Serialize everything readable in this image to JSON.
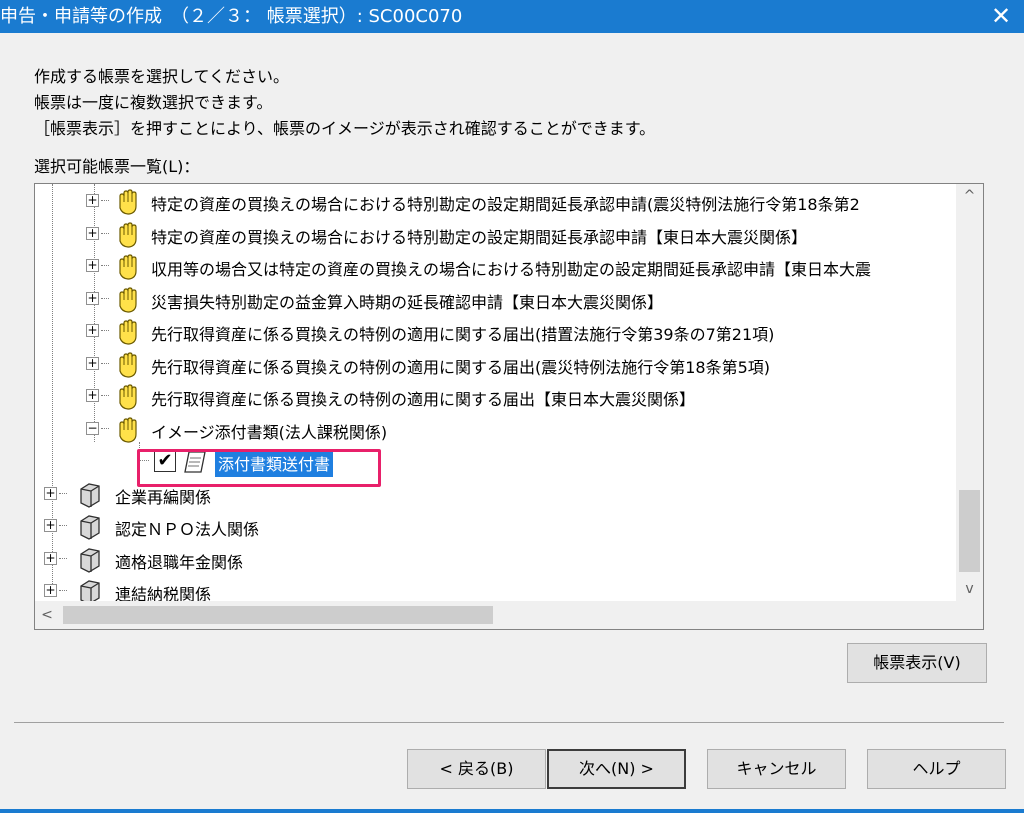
{
  "window": {
    "title": "申告・申請等の作成　（２／３：  帳票選択）: SC00C070",
    "close_glyph": "✕"
  },
  "instructions": [
    "作成する帳票を選択してください。",
    "帳票は一度に複数選択できます。",
    "［帳票表示］を押すことにより、帳票のイメージが表示され確認することができます。"
  ],
  "list_label": "選択可能帳票一覧(L)：",
  "tree": {
    "items": [
      {
        "label": "特定の資産の買換えの場合における特別勘定の設定期間延長承認申請(震災特例法施行令第18条第2",
        "icon": "hand-folder-icon"
      },
      {
        "label": "特定の資産の買換えの場合における特別勘定の設定期間延長承認申請【東日本大震災関係】",
        "icon": "hand-folder-icon"
      },
      {
        "label": "収用等の場合又は特定の資産の買換えの場合における特別勘定の設定期間延長承認申請【東日本大震",
        "icon": "hand-folder-icon"
      },
      {
        "label": "災害損失特別勘定の益金算入時期の延長確認申請【東日本大震災関係】",
        "icon": "hand-folder-icon"
      },
      {
        "label": "先行取得資産に係る買換えの特例の適用に関する届出(措置法施行令第39条の7第21項)",
        "icon": "hand-folder-icon"
      },
      {
        "label": "先行取得資産に係る買換えの特例の適用に関する届出(震災特例法施行令第18条第5項)",
        "icon": "hand-folder-icon"
      },
      {
        "label": "先行取得資産に係る買換えの特例の適用に関する届出【東日本大震災関係】",
        "icon": "hand-folder-icon"
      },
      {
        "label": "イメージ添付書類(法人課税関係)",
        "icon": "hand-folder-icon",
        "expanded": true
      }
    ],
    "child": {
      "label": "添付書類送付書",
      "checked": true,
      "check_glyph": "✔"
    },
    "groups": [
      {
        "label": "企業再編関係",
        "icon": "book-icon"
      },
      {
        "label": "認定ＮＰＯ法人関係",
        "icon": "book-icon"
      },
      {
        "label": "適格退職年金関係",
        "icon": "book-icon"
      },
      {
        "label": "連結納税関係",
        "icon": "book-icon"
      }
    ],
    "expander_plus": "+",
    "expander_minus": "−",
    "scroll_up": "^",
    "scroll_down": "v",
    "scroll_left": "<",
    "scroll_right": ">"
  },
  "buttons": {
    "view_form": "帳票表示(V)",
    "back": "< 戻る(B)",
    "next": "次へ(N) >",
    "cancel": "キャンセル",
    "help": "ヘルプ"
  },
  "colors": {
    "titlebar": "#1a7bd0",
    "selection": "#1f7fe0",
    "highlight": "#e8206a"
  }
}
